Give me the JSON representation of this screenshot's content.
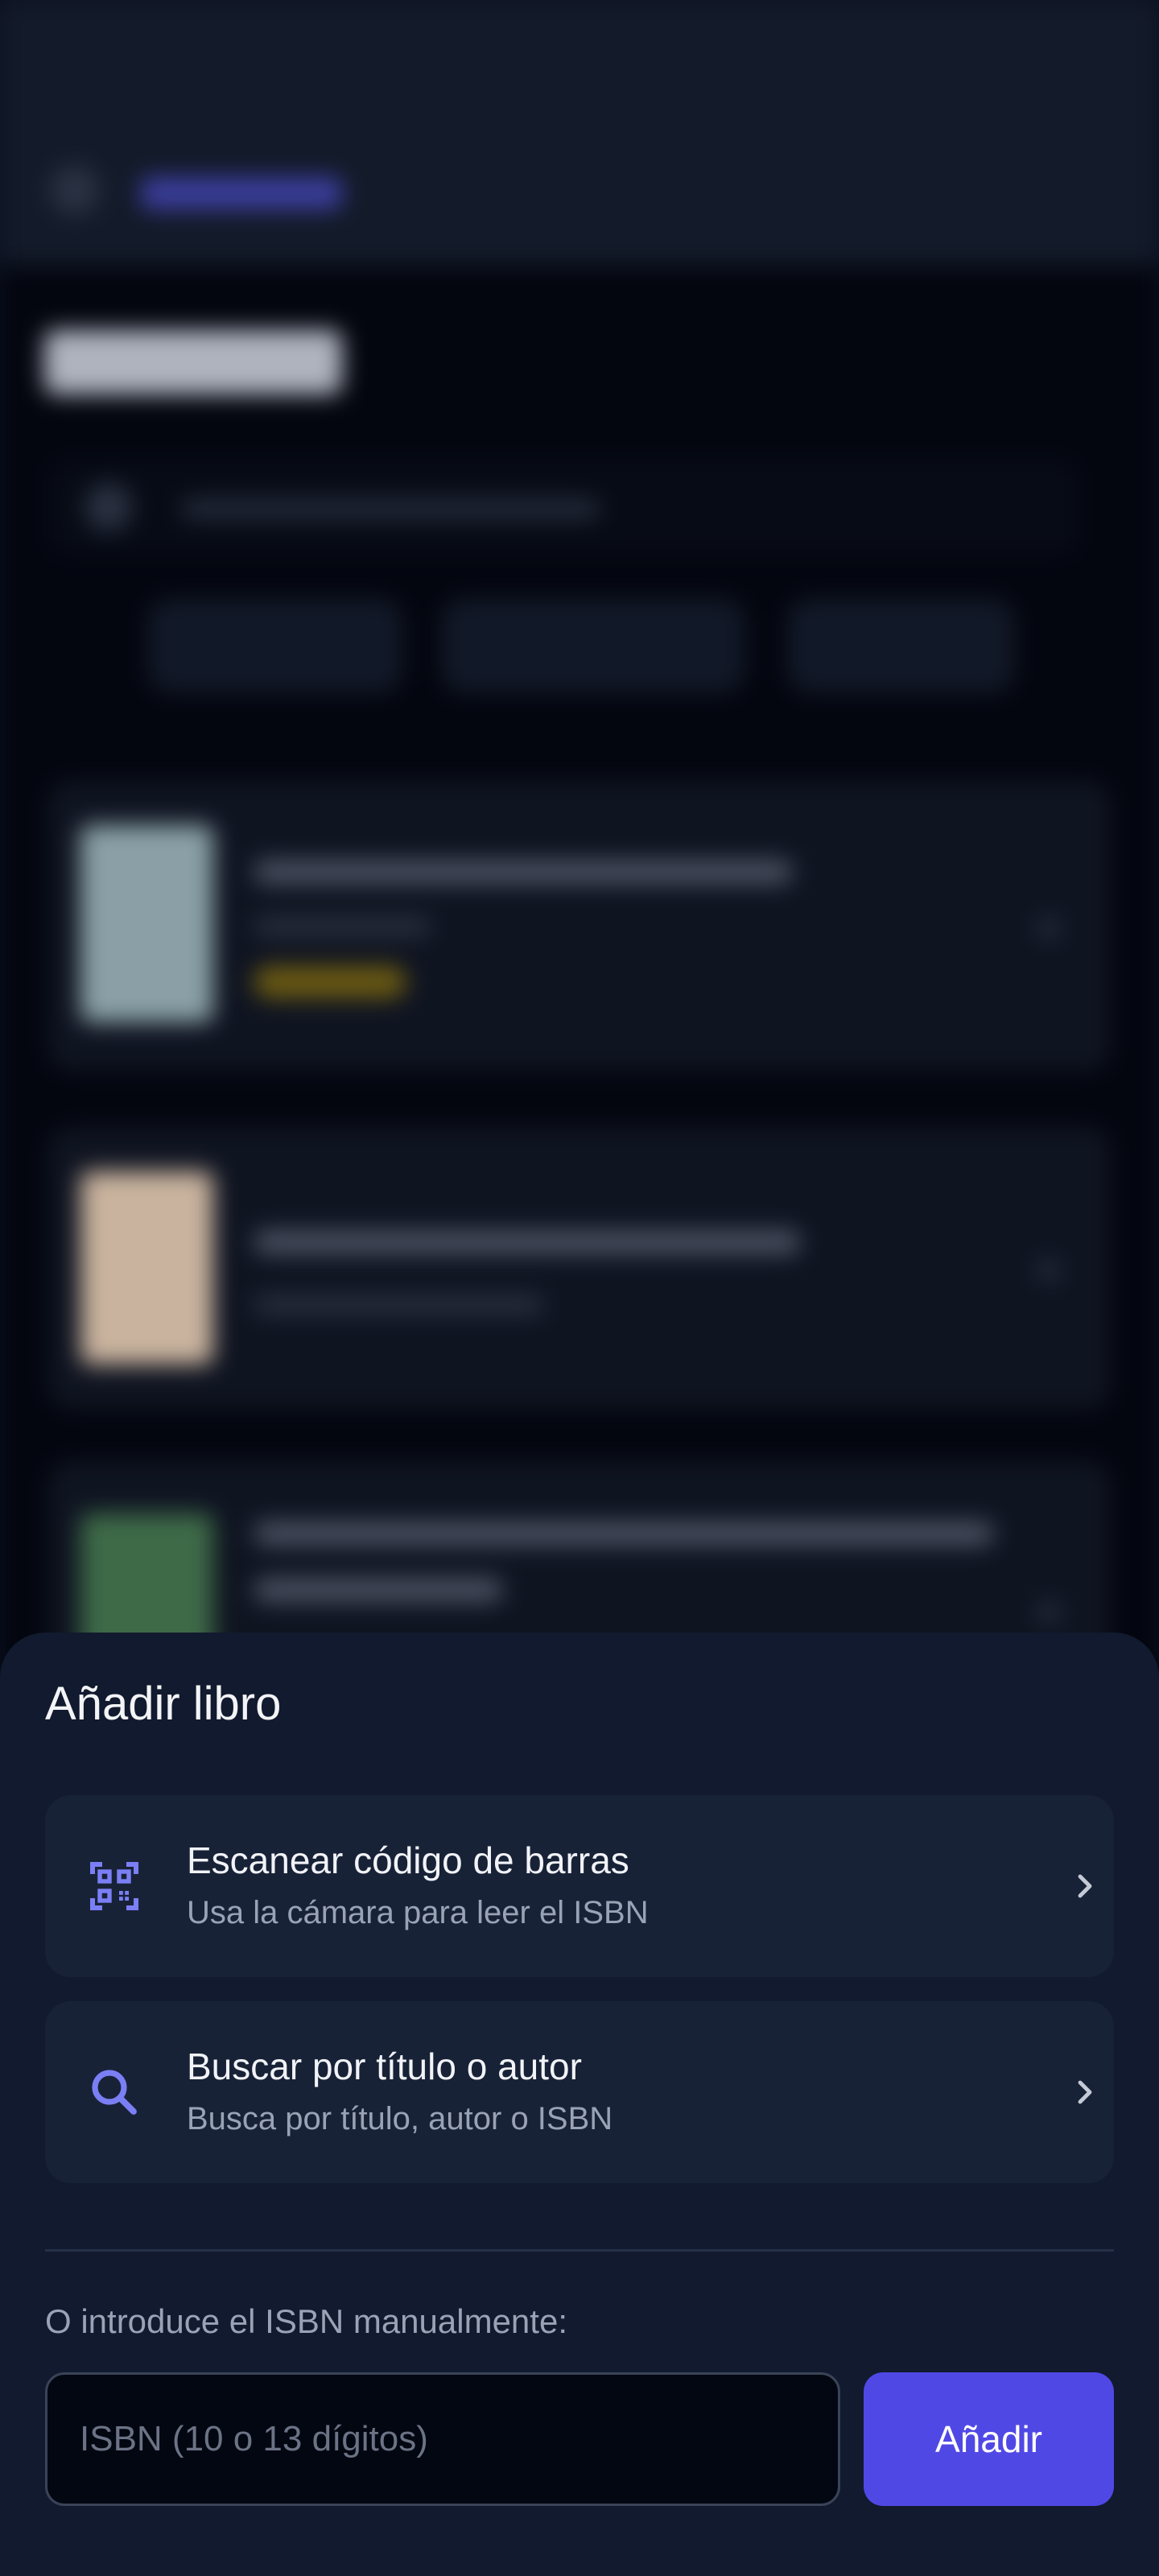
{
  "sheet": {
    "title": "Añadir libro",
    "options": [
      {
        "icon": "qr-code-scan-icon",
        "label": "Escanear código de barras",
        "subtitle": "Usa la cámara para leer el ISBN"
      },
      {
        "icon": "search-icon",
        "label": "Buscar por título o autor",
        "subtitle": "Busca por título, autor o ISBN"
      }
    ],
    "manual_label": "O introduce el ISBN manualmente:",
    "isbn_placeholder": "ISBN (10 o 13 dígitos)",
    "isbn_value": "",
    "add_button": "Añadir"
  },
  "colors": {
    "sheet_background": "#111a2e",
    "card_background": "#182237",
    "accent": "#5048e5",
    "icon_accent": "#7b7ff5",
    "text_primary": "#f1f3f7",
    "text_secondary": "#9aa3b5"
  }
}
